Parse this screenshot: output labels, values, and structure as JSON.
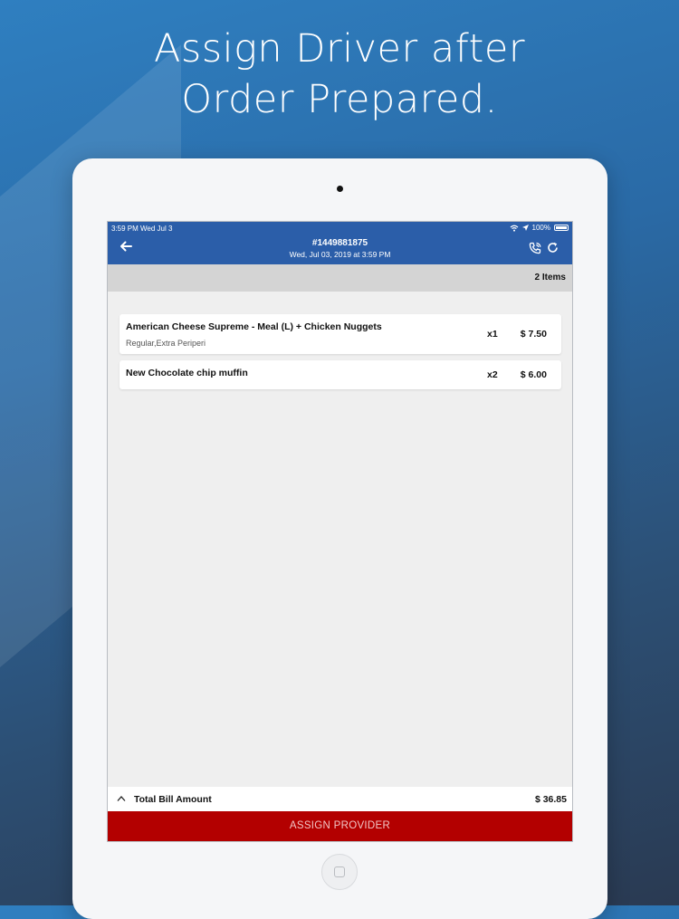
{
  "headline": {
    "line1": "Assign Driver after",
    "line2": "Order Prepared."
  },
  "status_bar": {
    "time": "3:59 PM  Wed Jul 3",
    "battery": "100%"
  },
  "header": {
    "order_id": "#1449881875",
    "order_date": "Wed, Jul 03, 2019 at 3:59 PM"
  },
  "items_count": "2 Items",
  "items": [
    {
      "name": "American Cheese Supreme -  Meal (L) + Chicken Nuggets",
      "options": "Regular,Extra Periperi",
      "qty": "x1",
      "price": "$ 7.50"
    },
    {
      "name": "New Chocolate chip muffin",
      "qty": "x2",
      "price": "$ 6.00"
    }
  ],
  "total": {
    "label": "Total Bill Amount",
    "amount": "$ 36.85"
  },
  "assign_button": "ASSIGN PROVIDER",
  "colors": {
    "appbar": "#2b5ea9",
    "assign_button": "#b30000",
    "items_bar": "#d4d4d4"
  },
  "icons": [
    "back-arrow-icon",
    "phone-call-icon",
    "refresh-icon",
    "chevron-up-icon",
    "wifi-icon",
    "location-arrow-icon",
    "battery-icon"
  ]
}
